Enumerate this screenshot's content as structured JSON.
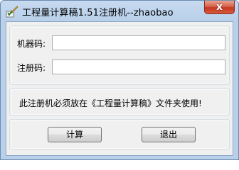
{
  "window": {
    "title": "工程量计算稿1.51注册机--zhaobao",
    "close_glyph": "x"
  },
  "form": {
    "machine_code_label": "机器码:",
    "machine_code_value": "",
    "register_code_label": "注册码:",
    "register_code_value": ""
  },
  "notice": {
    "text": "此注册机必须放在《工程量计算稿》文件夹使用!"
  },
  "buttons": {
    "calculate_label": "计算",
    "exit_label": "退出"
  }
}
